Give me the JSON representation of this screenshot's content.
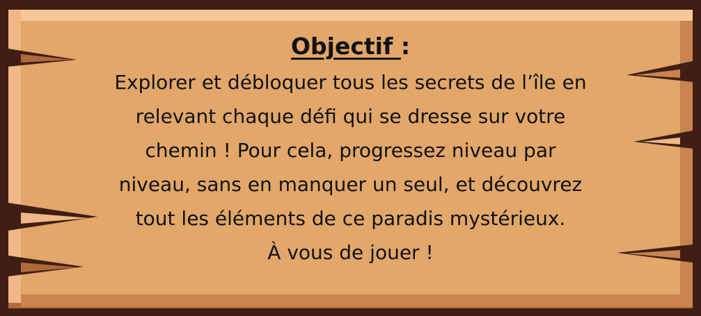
{
  "panel": {
    "title_word": "Objectif ",
    "title_colon": ":",
    "lines": [
      "Explorer et débloquer tous les secrets de l’île en",
      "relevant chaque défi qui se dresse sur votre",
      "chemin ! Pour cela, progressez niveau par",
      "niveau, sans en manquer un seul, et découvrez",
      "tout les éléments de ce paradis mystérieux.",
      "À vous de jouer !"
    ]
  },
  "colors": {
    "outer_frame": "#3f1f14",
    "board_face": "#e2a769",
    "board_highlight": "#f6c899",
    "board_shadow": "#b0693a",
    "text": "#111111"
  }
}
